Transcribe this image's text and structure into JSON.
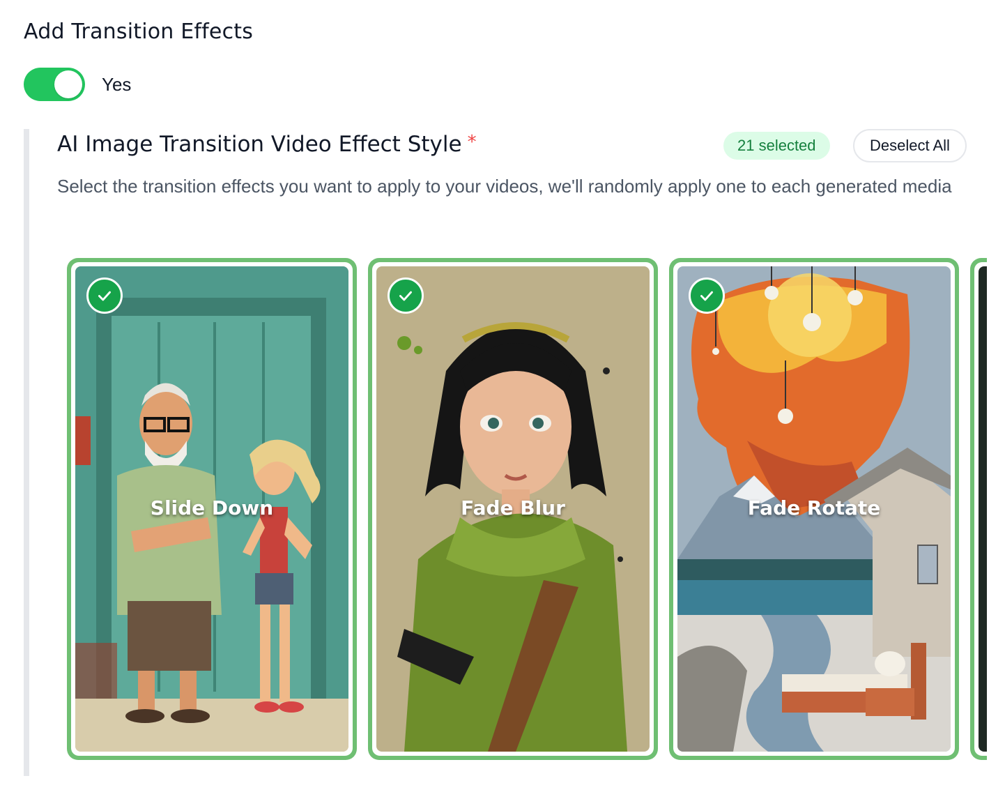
{
  "transition_effects": {
    "title": "Add Transition Effects",
    "toggle_label": "Yes",
    "toggle_on": true
  },
  "effect_style": {
    "title": "AI Image Transition Video Effect Style",
    "required_marker": "*",
    "selected_count_label": "21 selected",
    "deselect_all_label": "Deselect All",
    "description": "Select the transition effects you want to apply to your videos, we'll randomly apply one to each generated media",
    "cards": [
      {
        "label": "Slide Down",
        "selected": true,
        "icon": "check-icon"
      },
      {
        "label": "Fade Blur",
        "selected": true,
        "icon": "check-icon"
      },
      {
        "label": "Fade Rotate",
        "selected": true,
        "icon": "check-icon"
      }
    ]
  },
  "colors": {
    "accent_green": "#22c55e",
    "card_border": "#6fbf73",
    "badge_bg": "#dcfce7",
    "badge_text": "#15803d",
    "required_star": "#ef4444"
  }
}
